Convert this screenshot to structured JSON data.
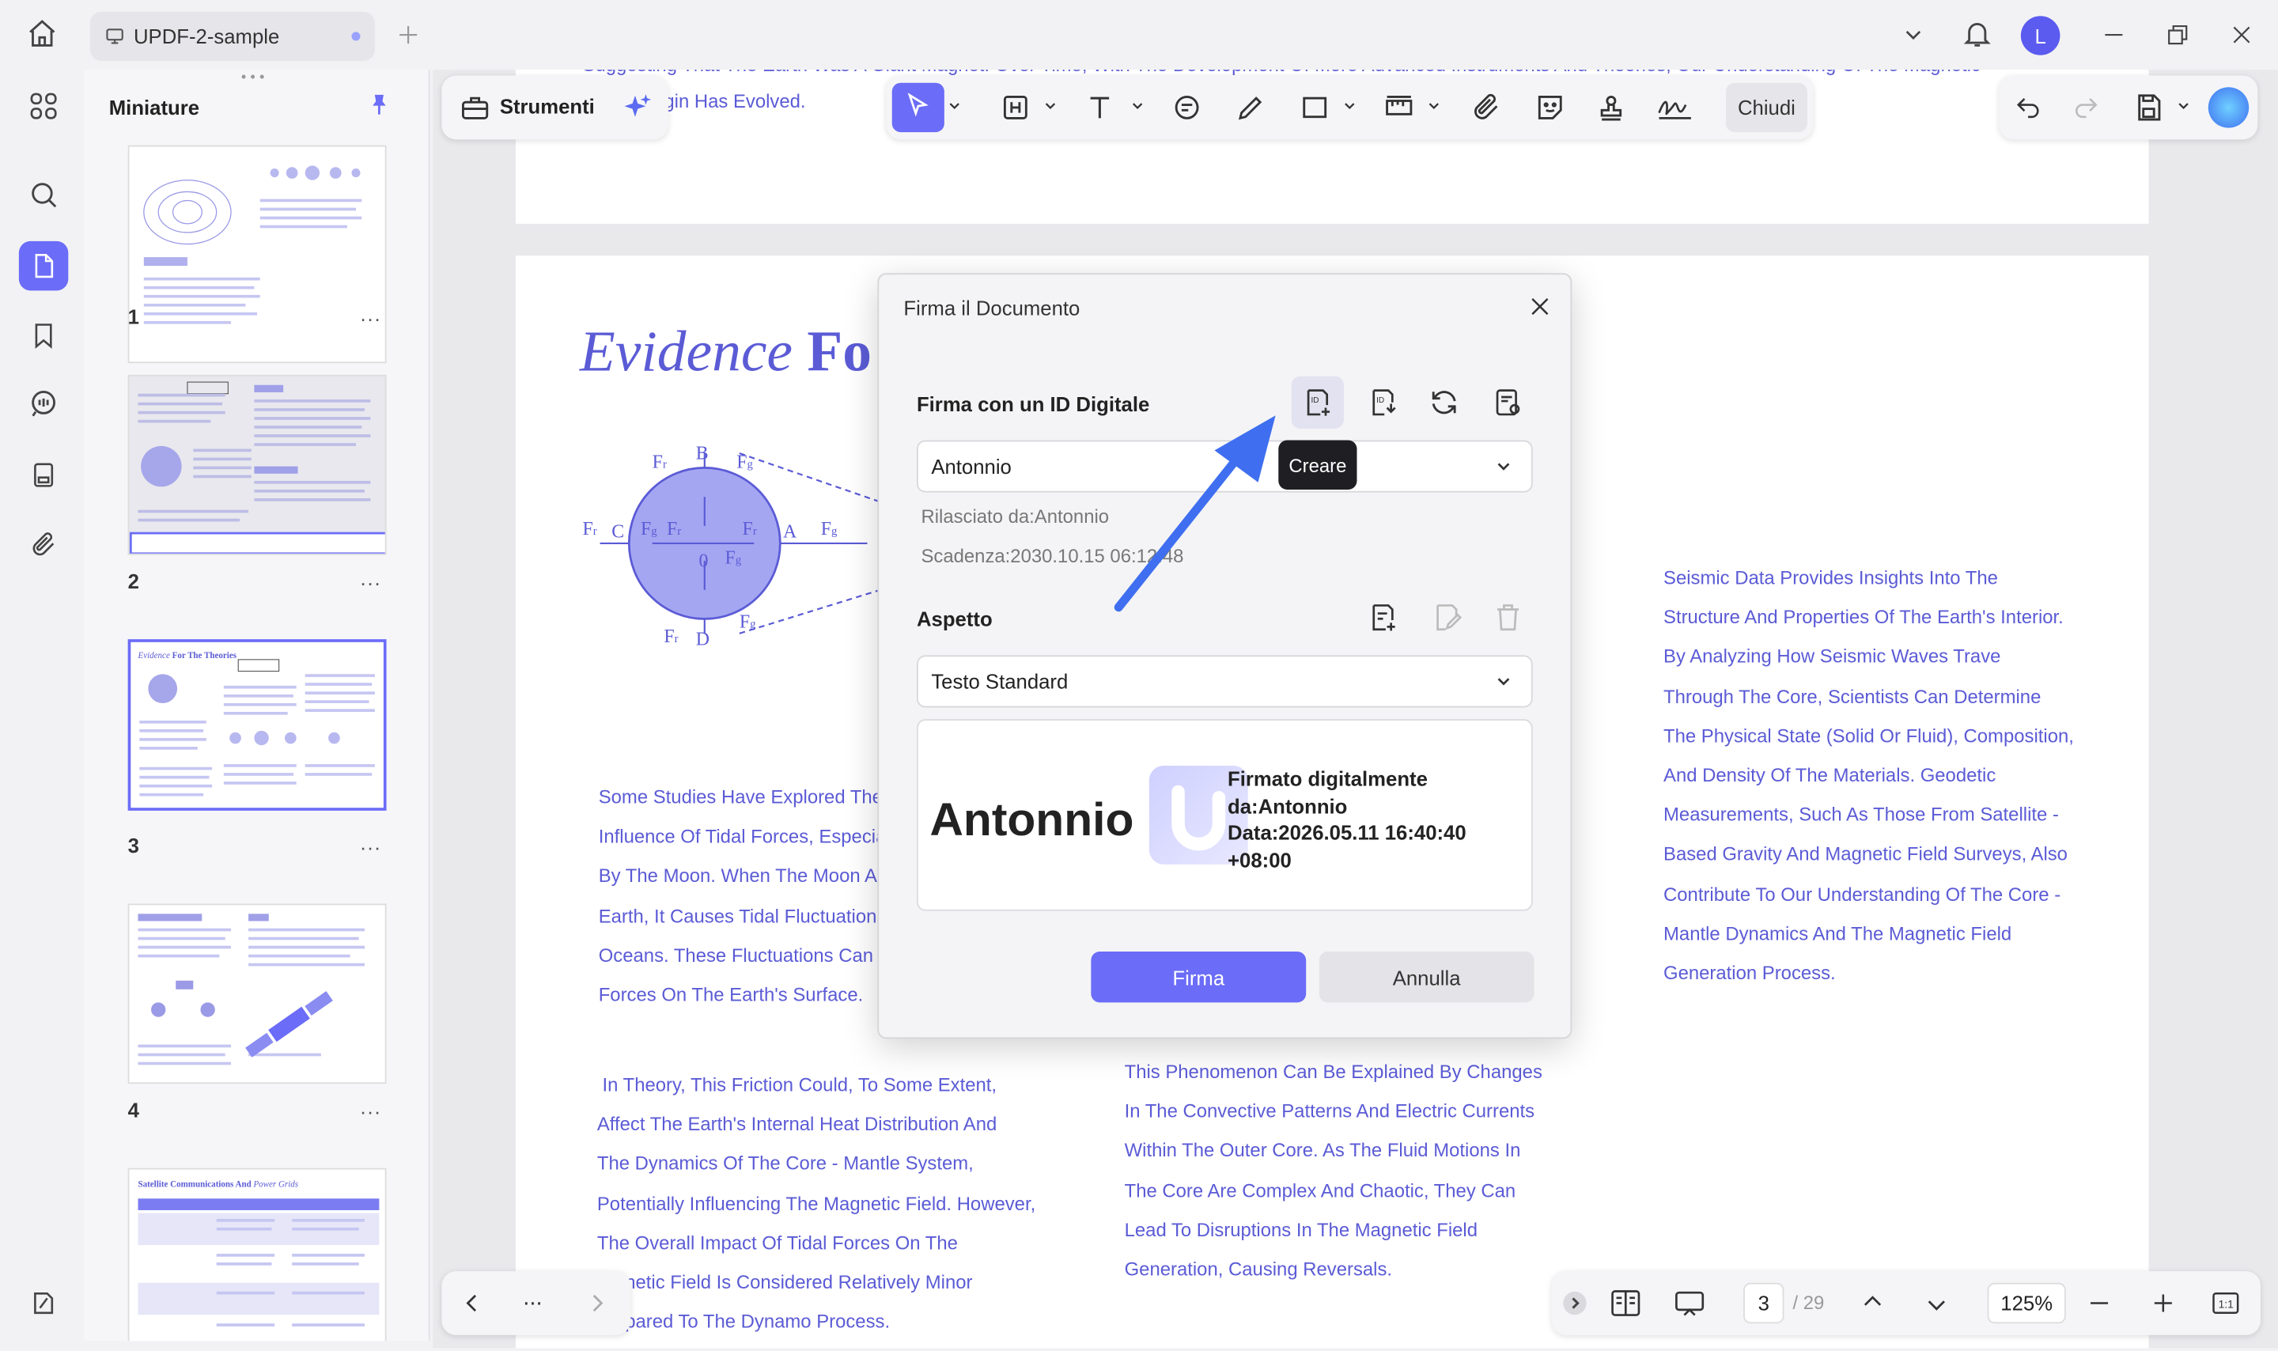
{
  "window": {
    "tab_title": "UPDF-2-sample",
    "avatar_letter": "L"
  },
  "sidebar": {
    "title": "Miniature",
    "pages": [
      {
        "number": "1"
      },
      {
        "number": "2"
      },
      {
        "number": "3"
      },
      {
        "number": "4"
      },
      {
        "number": ""
      }
    ],
    "more_label": "..."
  },
  "toolbar": {
    "tools_label": "Strumenti",
    "close_label": "Chiudi"
  },
  "document": {
    "top_text_1": "Suggesting That The Earth Was A Giant Magnet. Over Time, With The Development Of More Advanced Instruments And Theories, Our Understanding Of The Magnetic",
    "top_text_2": "gin Has Evolved.",
    "heading_italic": "Evidence",
    "heading_bold": "Fo",
    "left_col_1": [
      "Some Studies Have Explored The",
      "Influence Of Tidal Forces, Especia",
      "By The Moon. When The Moon Ap",
      "Earth, It Causes Tidal Fluctuations",
      "Oceans. These Fluctuations Can C",
      "Forces On The Earth's Surface."
    ],
    "left_col_2": [
      " In Theory, This Friction Could, To Some Extent,",
      "Affect The Earth's Internal Heat Distribution And",
      "The Dynamics Of The Core - Mantle System,",
      "Potentially Influencing The Magnetic Field. However,",
      "The Overall Impact Of Tidal Forces On The",
      "gnetic Field Is Considered Relatively Minor",
      "npared To The Dynamo Process."
    ],
    "mid_col": [
      "This Phenomenon Can Be Explained By Changes",
      "In The Convective Patterns And Electric Currents",
      "Within The Outer Core. As The Fluid Motions In",
      "The Core Are Complex And Chaotic, They Can",
      "Lead To Disruptions In The Magnetic Field",
      "Generation, Causing Reversals."
    ],
    "right_col": [
      "Seismic Data Provides Insights Into The",
      "Structure And Properties Of The Earth's Interior.",
      "By Analyzing How Seismic Waves Trave",
      "Through The Core, Scientists Can Determine",
      "The Physical State (Solid Or Fluid), Composition,",
      "And Density Of The Materials. Geodetic",
      "Measurements, Such As Those From Satellite -",
      "Based Gravity And Magnetic Field Surveys, Also",
      "Contribute To Our Understanding Of The Core -",
      "Mantle Dynamics And The Magnetic Field",
      "Generation Process."
    ],
    "diagram_labels": {
      "B": "B",
      "D": "D",
      "C": "C",
      "A": "A",
      "O": "0",
      "Fr": "F",
      "Fg": "F"
    }
  },
  "dialog": {
    "title": "Firma il Documento",
    "section_id": "Firma con un ID Digitale",
    "tooltip": "Creare",
    "id_select_value": "Antonnio",
    "issued_by": "Rilasciato da:Antonnio",
    "expiry": "Scadenza:2030.10.15 06:12:48",
    "section_appearance": "Aspetto",
    "appearance_select_value": "Testo Standard",
    "preview_name": "Antonnio",
    "preview_line1": "Firmato digitalmente",
    "preview_line2": "da:Antonnio",
    "preview_line3": "Data:2026.05.11 16:40:40",
    "preview_line4": "+08:00",
    "sign_button": "Firma",
    "cancel_button": "Annulla"
  },
  "bottom_nav": {
    "more": "...",
    "current_page": "3",
    "total_pages": "/ 29",
    "zoom": "125%"
  },
  "colors": {
    "accent": "#6b6cf7",
    "text_blue": "#5b5bd6",
    "arrow": "#3f6ff0"
  }
}
